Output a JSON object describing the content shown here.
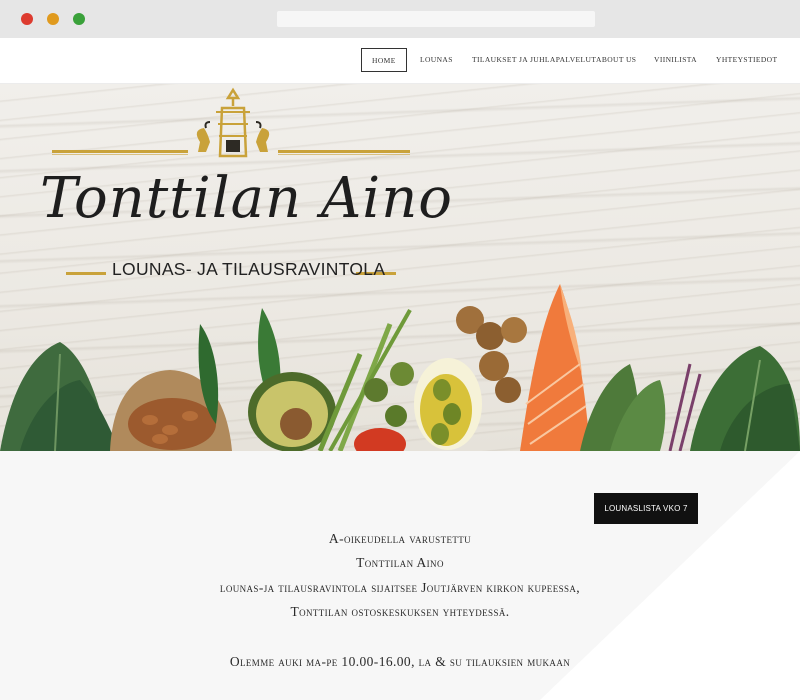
{
  "nav": {
    "items": [
      {
        "label": "HOME"
      },
      {
        "label": "LOUNAS"
      },
      {
        "label": "TILAUKSET JA JUHLAPALVELUT"
      },
      {
        "label": "ABOUT US"
      },
      {
        "label": "VIINILISTA"
      },
      {
        "label": "YHTEYSTIEDOT"
      }
    ]
  },
  "hero": {
    "logo_script": "Tonttilan Aino",
    "logo_subtitle": "LOUNAS- JA TILAUSRAVINTOLA"
  },
  "content": {
    "lounas_button": "LOUNASLISTA VKO 7",
    "lines": [
      "A-oikeudella varustettu",
      "Tonttilan Aino",
      "lounas-ja tilausravintola sijaitsee Joutjärven kirkon kupeessa,",
      "Tonttilan ostoskeskuksen yhteydessä.",
      "Olemme auki ma-pe 10.00-16.00, la & su tilauksien mukaan"
    ]
  },
  "colors": {
    "dot_red": "#dd3b2f",
    "dot_yellow": "#e09a1e",
    "dot_green": "#3aa13a",
    "gold": "#c9a23a",
    "button_bg": "#111111"
  }
}
